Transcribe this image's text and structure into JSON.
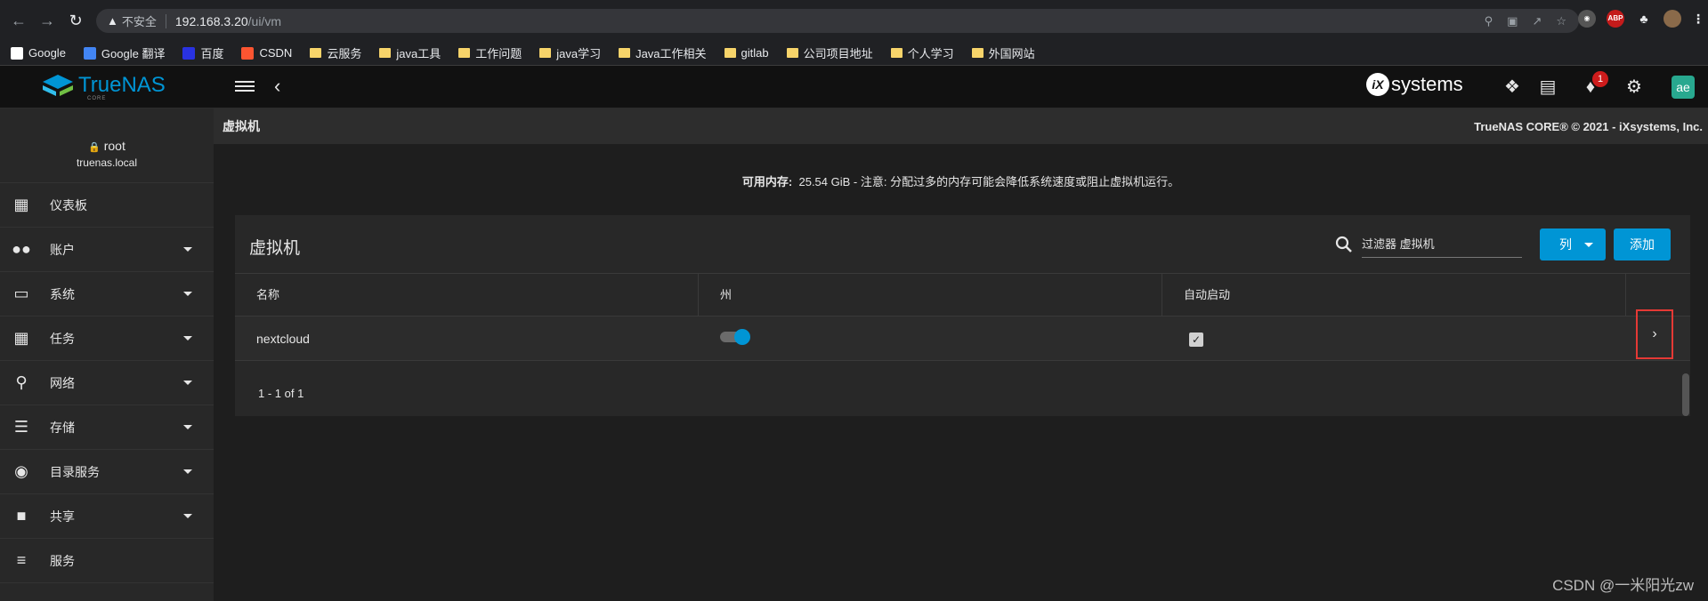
{
  "browser": {
    "insecure_label": "不安全",
    "url_host": "192.168.3.20",
    "url_path": "/ui/vm",
    "extensions": [
      "ABP"
    ]
  },
  "bookmarks": [
    {
      "label": "Google",
      "icon": "google-icon"
    },
    {
      "label": "Google 翻译",
      "icon": "translate-icon"
    },
    {
      "label": "百度",
      "icon": "baidu-icon"
    },
    {
      "label": "CSDN",
      "icon": "csdn-icon"
    },
    {
      "label": "云服务",
      "icon": "folder-icon"
    },
    {
      "label": "java工具",
      "icon": "folder-icon"
    },
    {
      "label": "工作问题",
      "icon": "folder-icon"
    },
    {
      "label": "java学习",
      "icon": "folder-icon"
    },
    {
      "label": "Java工作相关",
      "icon": "folder-icon"
    },
    {
      "label": "gitlab",
      "icon": "folder-icon"
    },
    {
      "label": "公司项目地址",
      "icon": "folder-icon"
    },
    {
      "label": "个人学习",
      "icon": "folder-icon"
    },
    {
      "label": "外国网站",
      "icon": "folder-icon"
    }
  ],
  "header": {
    "logo_text": "TrueNAS",
    "logo_sub": "CORE",
    "vendor": "systems",
    "vendor_mark": "iX",
    "notification_count": "1",
    "avatar_text": "ae"
  },
  "sidebar": {
    "user": "root",
    "host": "truenas.local",
    "items": [
      {
        "label": "仪表板",
        "icon": "dashboard-icon",
        "has_caret": false
      },
      {
        "label": "账户",
        "icon": "people-icon",
        "has_caret": true
      },
      {
        "label": "系统",
        "icon": "laptop-icon",
        "has_caret": true
      },
      {
        "label": "任务",
        "icon": "calendar-icon",
        "has_caret": true
      },
      {
        "label": "网络",
        "icon": "network-icon",
        "has_caret": true
      },
      {
        "label": "存储",
        "icon": "storage-icon",
        "has_caret": true
      },
      {
        "label": "目录服务",
        "icon": "directory-icon",
        "has_caret": true
      },
      {
        "label": "共享",
        "icon": "share-folder-icon",
        "has_caret": true
      },
      {
        "label": "服务",
        "icon": "tune-icon",
        "has_caret": false
      }
    ]
  },
  "page": {
    "title": "虚拟机",
    "copyright": "TrueNAS CORE® © 2021 - iXsystems, Inc.",
    "memory_label": "可用内存:",
    "memory_value": "25.54 GiB - 注意: 分配过多的内存可能会降低系统速度或阻止虚拟机运行。"
  },
  "card": {
    "title": "虚拟机",
    "search_placeholder": "过滤器 虚拟机",
    "columns_button": "列",
    "add_button": "添加",
    "headers": [
      "名称",
      "州",
      "自动启动"
    ],
    "rows": [
      {
        "name": "nextcloud",
        "state_on": true,
        "autostart": true
      }
    ],
    "pager": "1 - 1 of 1"
  },
  "colors": {
    "accent": "#0095d5",
    "highlight_border": "#e53935",
    "badge": "#ce1c1c"
  },
  "watermark": "CSDN @一米阳光zw"
}
